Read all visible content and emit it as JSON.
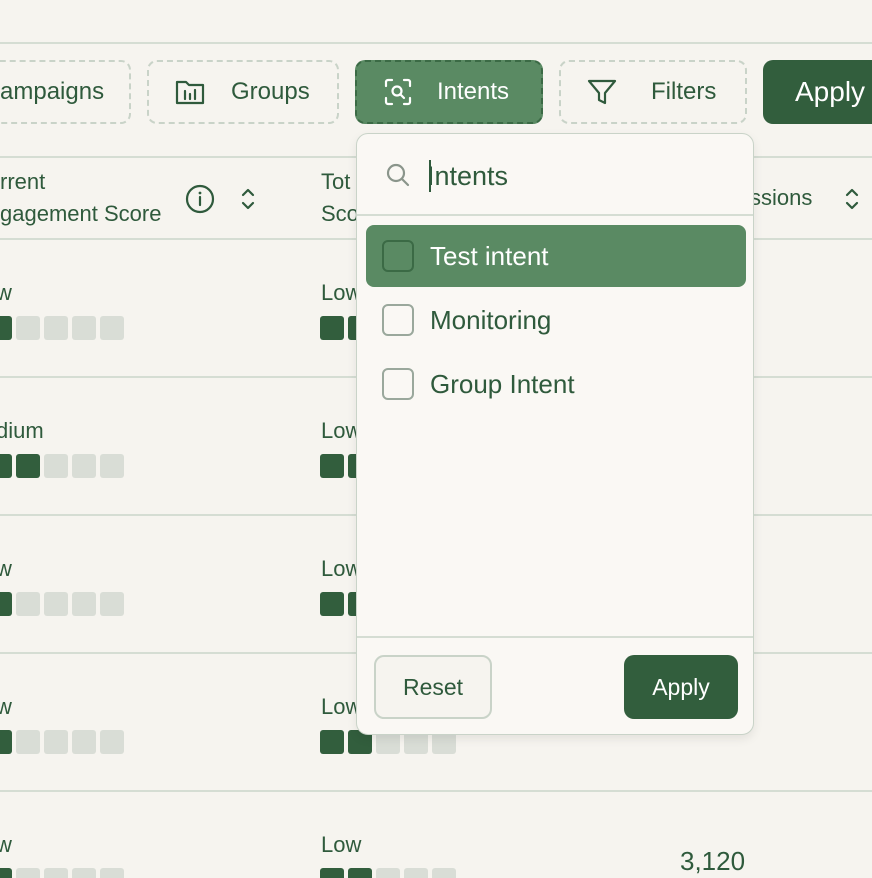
{
  "toolbar": {
    "campaigns_label": "ampaigns",
    "groups_label": "Groups",
    "intents_label": "Intents",
    "filters_label": "Filters",
    "apply_label": "Apply",
    "icons": {
      "groups": "folder-chart-icon",
      "intents": "scan-search-icon",
      "filters": "funnel-icon"
    }
  },
  "table": {
    "headers": {
      "current_engagement_line1": "rrent",
      "current_engagement_line2": "gagement Score",
      "total_line1": "Tot",
      "total_line2": "Sco",
      "sessions": "ssions"
    },
    "rows": [
      {
        "current_level": "w",
        "current_filled": 1,
        "total_level": "Low",
        "total_filled": 2,
        "sessions": ""
      },
      {
        "current_level": "dium",
        "current_filled": 2,
        "total_level": "Low",
        "total_filled": 2,
        "sessions": ""
      },
      {
        "current_level": "w",
        "current_filled": 1,
        "total_level": "Low",
        "total_filled": 2,
        "sessions": ""
      },
      {
        "current_level": "w",
        "current_filled": 1,
        "total_level": "Low",
        "total_filled": 2,
        "sessions": ""
      },
      {
        "current_level": "w",
        "current_filled": 1,
        "total_level": "Low",
        "total_filled": 2,
        "sessions": "3,120"
      }
    ],
    "score_max": 5
  },
  "dropdown": {
    "search_placeholder": "Intents",
    "options": [
      {
        "label": "Test intent",
        "checked": false,
        "highlighted": true
      },
      {
        "label": "Monitoring",
        "checked": false,
        "highlighted": false
      },
      {
        "label": "Group Intent",
        "checked": false,
        "highlighted": false
      }
    ],
    "reset_label": "Reset",
    "apply_label": "Apply"
  },
  "colors": {
    "primary": "#325e3d",
    "highlight": "#5a8a63",
    "background": "#f6f4ef",
    "text": "#2f5a3c"
  }
}
